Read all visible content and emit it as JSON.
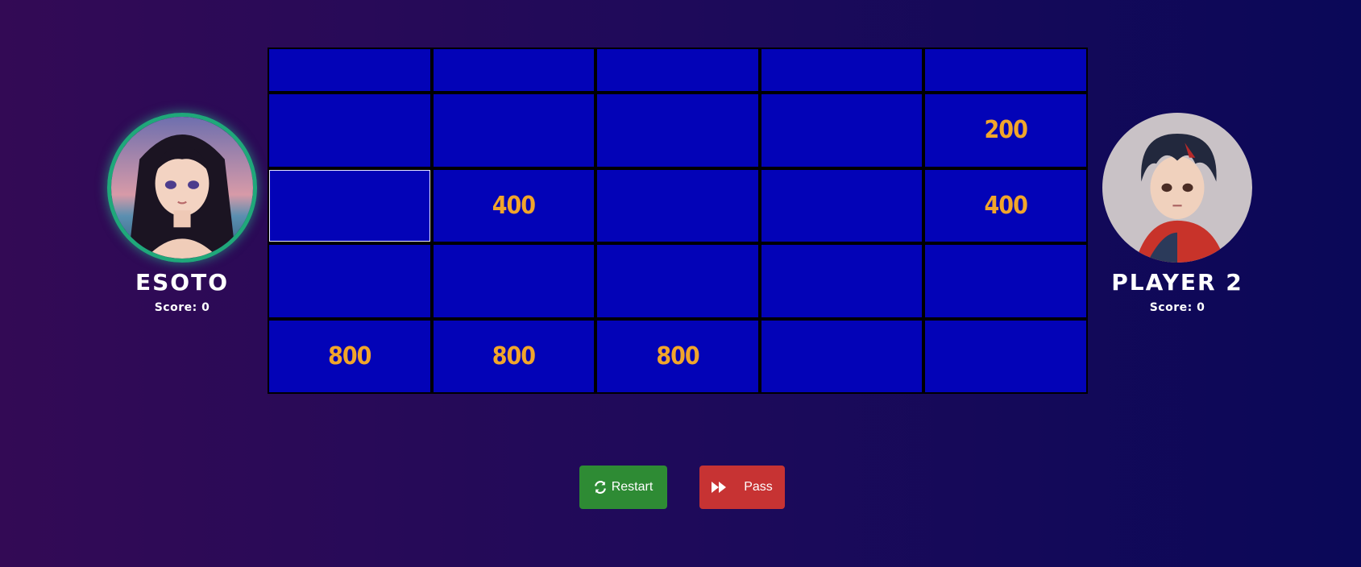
{
  "players": [
    {
      "name": "ESOTO",
      "score_label": "Score:",
      "score": "0",
      "active": true,
      "avatar": "anime-girl-avatar"
    },
    {
      "name": "PLAYER 2",
      "score_label": "Score:",
      "score": "0",
      "active": false,
      "avatar": "anime-boy-avatar"
    }
  ],
  "board": {
    "categories": [
      "",
      "",
      "",
      "",
      ""
    ],
    "rows": [
      [
        "",
        "",
        "",
        "",
        "200"
      ],
      [
        "",
        "400",
        "",
        "",
        "400"
      ],
      [
        "",
        "",
        "",
        "",
        ""
      ],
      [
        "800",
        "800",
        "800",
        "",
        ""
      ]
    ],
    "cell_color": "#0303b7",
    "value_color": "#f1a52b"
  },
  "buttons": {
    "restart_label": "Restart",
    "restart_icon": "refresh-icon",
    "restart_color": "#2e8b34",
    "pass_label": "Pass",
    "pass_icon": "fast-forward-icon",
    "pass_color": "#c73333"
  }
}
